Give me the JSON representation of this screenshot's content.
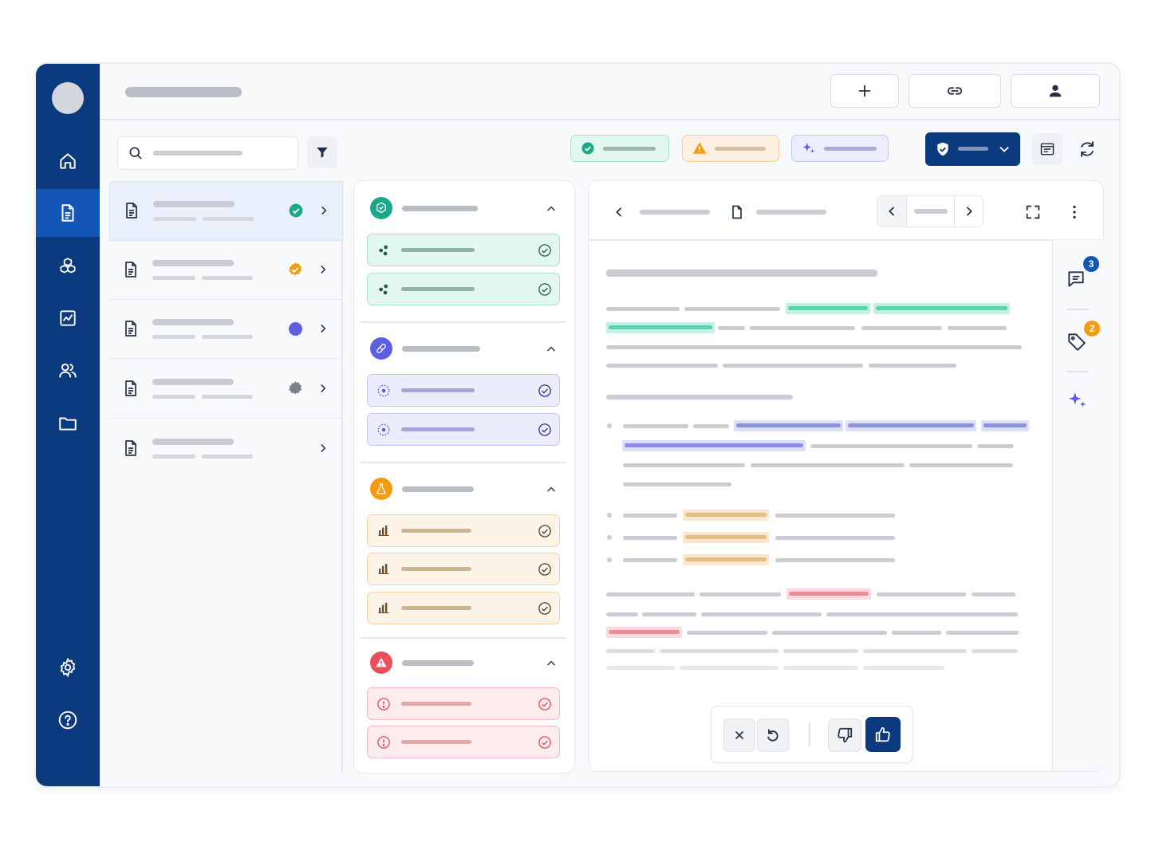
{
  "comments_badge": {
    "count": "3"
  },
  "tags_badge": {
    "count": "2"
  },
  "colors": {
    "sidebar": "#0b3a7e",
    "sidebar_active": "#1456b8",
    "green": "#1aa78a",
    "orange": "#f39c12",
    "purple": "#5b5fe0",
    "red": "#ea4f5b",
    "primary": "#0b3a7e"
  },
  "icons": {
    "sidebar": [
      "home-icon",
      "document-icon",
      "cubes-icon",
      "chart-icon",
      "users-icon",
      "folder-icon",
      "settings-icon",
      "help-icon"
    ],
    "topbar": [
      "plus-icon",
      "link-icon",
      "user-icon"
    ],
    "toolbar": [
      "search-icon",
      "filter-icon",
      "shield-check-icon",
      "chevron-down-icon",
      "panel-icon",
      "refresh-icon"
    ],
    "viewer": [
      "chevron-left-icon",
      "page-icon",
      "expand-icon",
      "more-vertical-icon",
      "comment-icon",
      "tag-icon",
      "sparkle-icon"
    ],
    "feedback": [
      "close-icon",
      "undo-icon",
      "thumbs-down-icon",
      "thumbs-up-icon"
    ]
  }
}
